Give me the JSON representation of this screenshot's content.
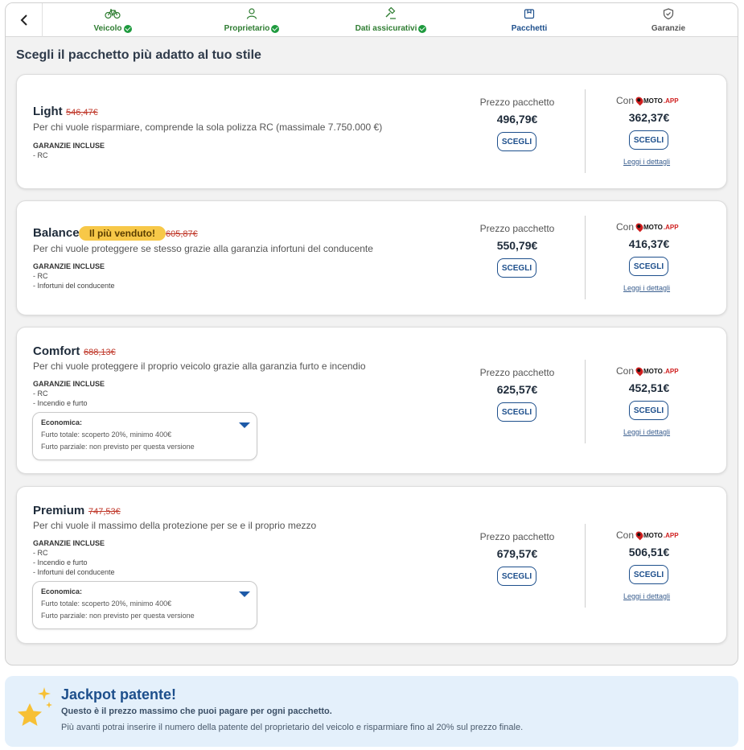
{
  "stepper": {
    "steps": [
      {
        "label": "Veicolo",
        "icon": "bicycle-icon",
        "status": "done"
      },
      {
        "label": "Proprietario",
        "icon": "user-icon",
        "status": "done"
      },
      {
        "label": "Dati assicurativi",
        "icon": "gavel-icon",
        "status": "done"
      },
      {
        "label": "Pacchetti",
        "icon": "package-icon",
        "status": "active"
      },
      {
        "label": "Garanzie",
        "icon": "shield-check-icon",
        "status": "todo"
      }
    ],
    "accent_done": "#2f7d32",
    "accent_active": "#1d4f8c"
  },
  "page_title": "Scegli il pacchetto più adatto al tuo stile",
  "common": {
    "price_label": "Prezzo pacchetto",
    "con_label": "Con",
    "choose_label": "SCEGLI",
    "details_link": "Leggi i dettagli",
    "guarantees_title": "GARANZIE INCLUSE",
    "brand_moto": "MOTO",
    "brand_app": ".APP"
  },
  "packages": [
    {
      "name": "Light",
      "old_price": "546,47€",
      "description": "Per chi vuole risparmiare, comprende la sola polizza RC (massimale 7.750.000 €)",
      "guarantees": [
        "- RC"
      ],
      "price": "496,79€",
      "con_price": "362,37€"
    },
    {
      "name": "Balance",
      "badge": "Il più venduto!",
      "old_price": "605,87€",
      "description": "Per chi vuole proteggere se stesso grazie alla garanzia infortuni del conducente",
      "guarantees": [
        "- RC",
        "- Infortuni del conducente"
      ],
      "price": "550,79€",
      "con_price": "416,37€"
    },
    {
      "name": "Comfort",
      "old_price": "688,13€",
      "description": "Per chi vuole proteggere il proprio veicolo grazie alla garanzia furto e incendio",
      "guarantees": [
        "- RC",
        "- Incendio e furto"
      ],
      "option": {
        "title": "Economica:",
        "line1": "Furto totale: scoperto 20%, minimo 400€",
        "line2": "Furto parziale: non previsto per questa versione"
      },
      "price": "625,57€",
      "con_price": "452,51€"
    },
    {
      "name": "Premium",
      "old_price": "747,53€",
      "description": "Per chi vuole il massimo della protezione per se e il proprio mezzo",
      "guarantees": [
        "- RC",
        "- Incendio e furto",
        "- Infortuni del conducente"
      ],
      "option": {
        "title": "Economica:",
        "line1": "Furto totale: scoperto 20%, minimo 400€",
        "line2": "Furto parziale: non previsto per questa versione"
      },
      "price": "679,57€",
      "con_price": "506,51€"
    }
  ],
  "jackpot": {
    "icon": "stars-icon",
    "title": "Jackpot patente!",
    "subtitle": "Questo è il prezzo massimo che puoi pagare per ogni pacchetto.",
    "text": "Più avanti potrai inserire il numero della patente del proprietario del veicolo e risparmiare fino al 20% sul prezzo finale."
  }
}
